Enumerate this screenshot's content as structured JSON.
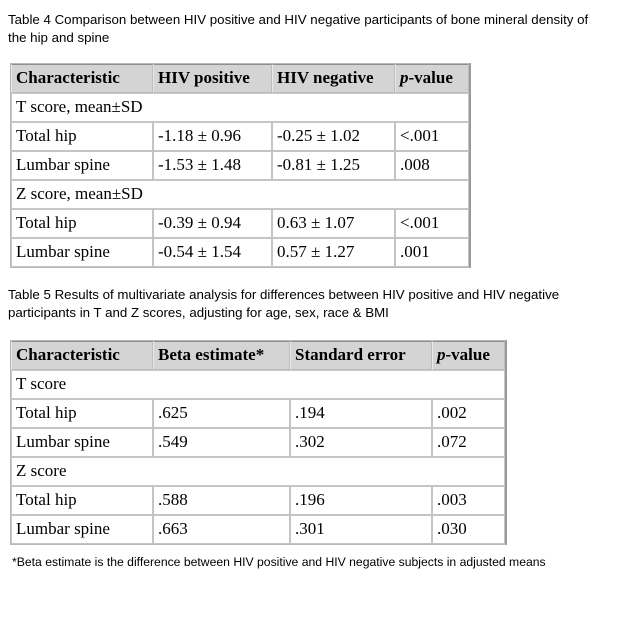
{
  "document": {
    "table4": {
      "caption": "Table 4 Comparison between HIV positive and HIV negative participants of bone mineral density of the hip and spine",
      "headers": {
        "col1": "Characteristic",
        "col2": "HIV positive",
        "col3": "HIV negative",
        "col4_italic": "p",
        "col4_rest": "-value"
      },
      "sections": [
        {
          "label": "T score, mean±SD",
          "rows": [
            {
              "characteristic": "Total hip",
              "hiv_positive": "-1.18 ± 0.96",
              "hiv_negative": "-0.25 ± 1.02",
              "p_value": "<.001"
            },
            {
              "characteristic": "Lumbar spine",
              "hiv_positive": "-1.53 ± 1.48",
              "hiv_negative": "-0.81 ± 1.25",
              "p_value": ".008"
            }
          ]
        },
        {
          "label": "Z score, mean±SD",
          "rows": [
            {
              "characteristic": "Total hip",
              "hiv_positive": "-0.39 ± 0.94",
              "hiv_negative": "0.63 ± 1.07",
              "p_value": "<.001"
            },
            {
              "characteristic": "Lumbar spine",
              "hiv_positive": "-0.54 ± 1.54",
              "hiv_negative": "0.57 ± 1.27",
              "p_value": ".001"
            }
          ]
        }
      ]
    },
    "table5": {
      "caption": "Table 5 Results of multivariate analysis for differences between HIV positive and HIV negative participants in T and Z scores, adjusting for age, sex, race & BMI",
      "headers": {
        "col1": "Characteristic",
        "col2": "Beta estimate*",
        "col3": "Standard error",
        "col4_italic": "p",
        "col4_rest": "-value"
      },
      "sections": [
        {
          "label": "T score",
          "rows": [
            {
              "characteristic": "Total hip",
              "beta_estimate": ".625",
              "standard_error": ".194",
              "p_value": ".002"
            },
            {
              "characteristic": "Lumbar spine",
              "beta_estimate": ".549",
              "standard_error": ".302",
              "p_value": ".072"
            }
          ]
        },
        {
          "label": "Z score",
          "rows": [
            {
              "characteristic": "Total hip",
              "beta_estimate": ".588",
              "standard_error": ".196",
              "p_value": ".003"
            },
            {
              "characteristic": "Lumbar spine",
              "beta_estimate": ".663",
              "standard_error": ".301",
              "p_value": ".030"
            }
          ]
        }
      ],
      "footnote": "*Beta estimate is the difference between HIV positive and HIV negative subjects in adjusted means"
    }
  },
  "colors": {
    "header_background": "#d4d4d4",
    "border": "#c4c4c4",
    "text": "#000000",
    "page_background": "#ffffff"
  }
}
